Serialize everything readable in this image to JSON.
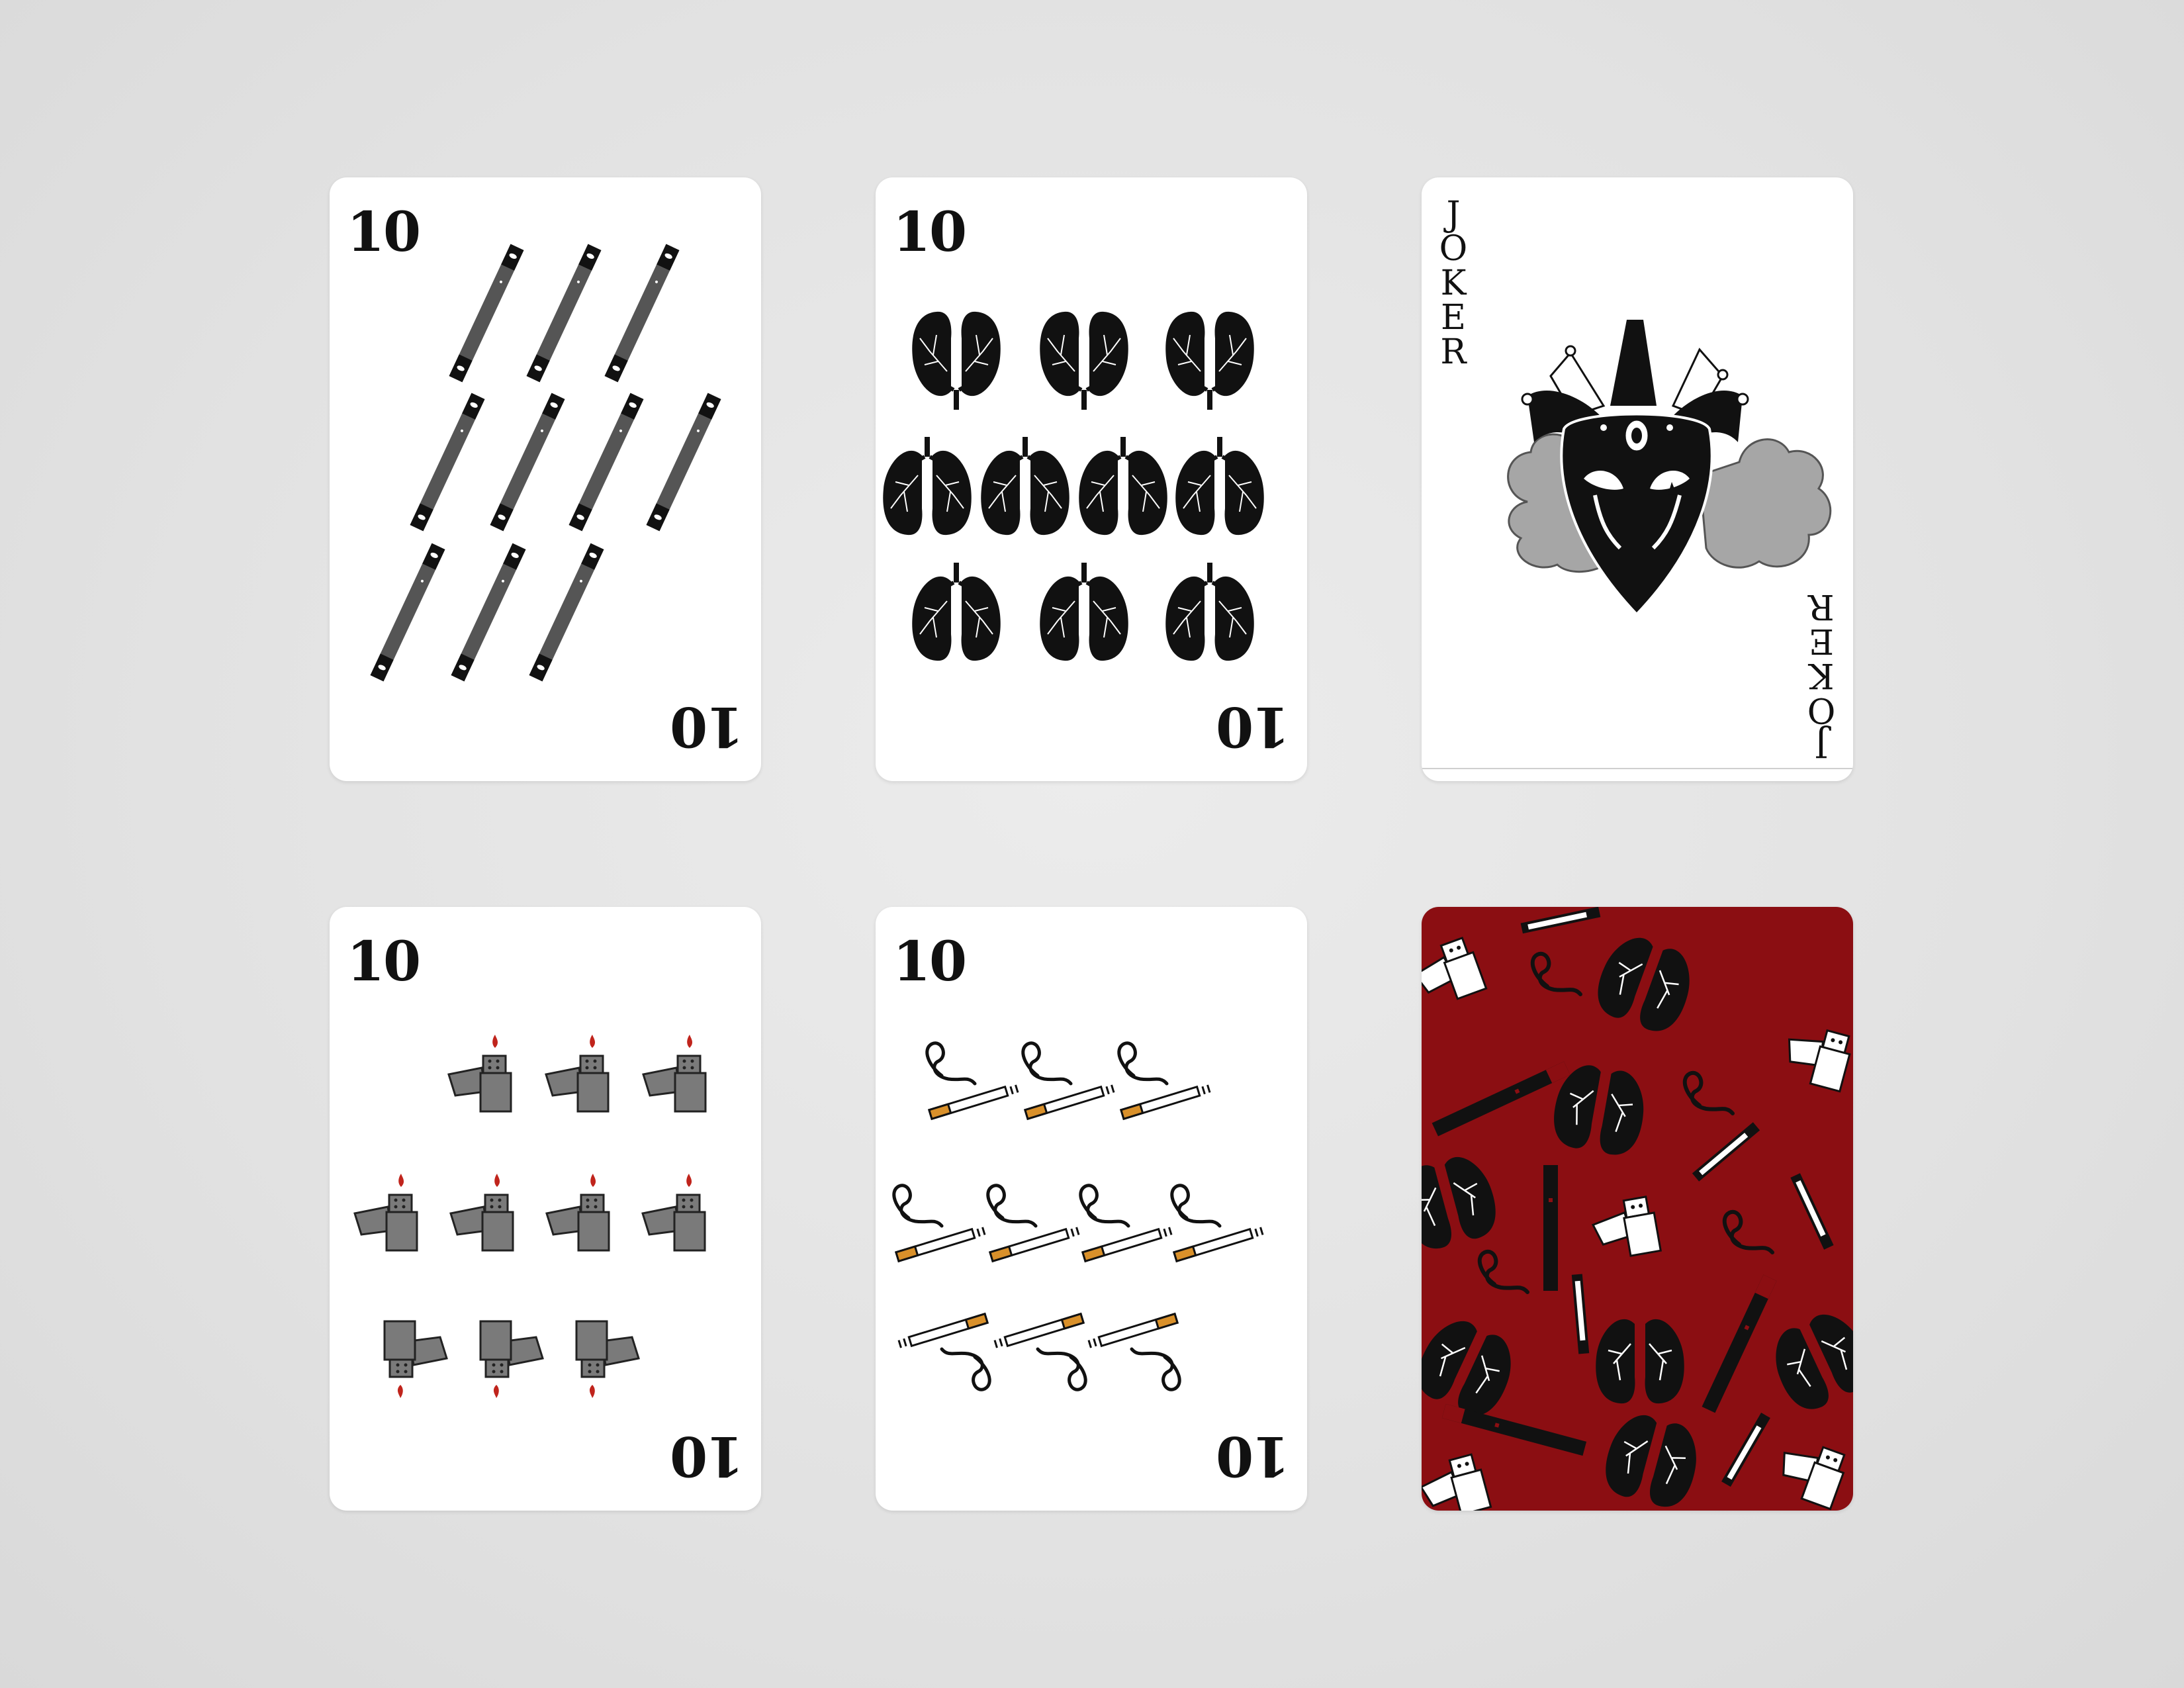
{
  "cards": [
    {
      "rank": "10",
      "suit_icon": "vape-pod-icon",
      "pip_count": 10
    },
    {
      "rank": "10",
      "suit_icon": "lungs-icon",
      "pip_count": 10
    },
    {
      "rank": "JOKER",
      "suit_icon": "jester-mask-icon"
    },
    {
      "rank": "10",
      "suit_icon": "lighter-icon",
      "pip_count": 10
    },
    {
      "rank": "10",
      "suit_icon": "cigarette-icon",
      "pip_count": 10
    },
    {
      "face": "back",
      "pattern_icons": [
        "lighter-icon",
        "vape-pod-icon",
        "lungs-icon",
        "cigarette-icon",
        "smoke-icon"
      ]
    }
  ],
  "colors": {
    "background": "#e2e2e2",
    "card_face": "#ffffff",
    "card_back": "#8b0e12",
    "ink": "#111111",
    "pod_gray": "#555555",
    "lighter_gray": "#7a7a7a",
    "flame_red": "#c0241c",
    "filter_orange": "#d9902a",
    "smoke_gray": "#a6a6a6"
  }
}
